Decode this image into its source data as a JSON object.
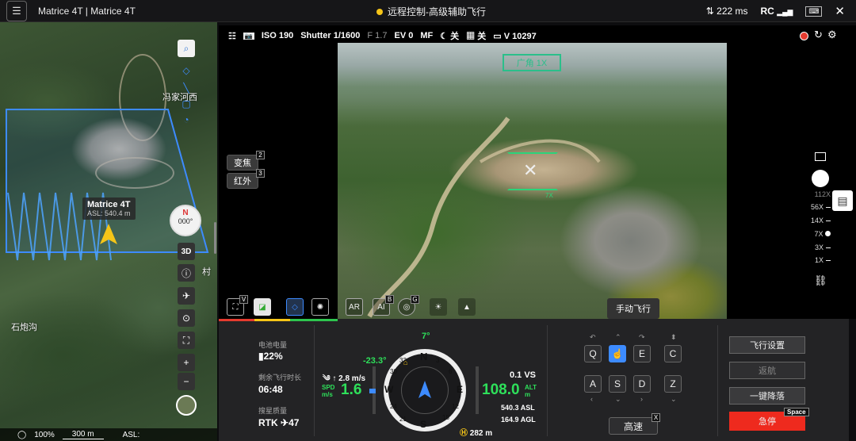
{
  "topbar": {
    "menu_icon": "menu-icon",
    "title": "Matrice 4T | Matrice 4T",
    "status": "远程控制-高级辅助飞行",
    "latency_icon": "signal-arrows-icon",
    "latency": "222 ms",
    "rc": "RC",
    "close": "✕"
  },
  "map": {
    "aircraft_name": "Matrice 4T",
    "aircraft_asl": "ASL: 540.4 m",
    "labels": {
      "village": "冯家河西",
      "place": "石炮沟",
      "east": "村"
    },
    "compass_n": "N",
    "compass_deg": "000°",
    "view_3d": "3D",
    "bottom": {
      "satellite": "100%",
      "scale": "300 m",
      "asl": "ASL:"
    }
  },
  "camera": {
    "iso": "ISO 190",
    "shutter": "Shutter 1/1600",
    "fstop": "F 1.7",
    "ev": "EV 0",
    "mf": "MF",
    "toggle1": "关",
    "toggle2": "关",
    "storage": "V 10297",
    "wide_label": "广角 1X",
    "zoom_center": "7X",
    "btn_visible": "变焦",
    "btn_visible_badge": "2",
    "btn_ir": "红外",
    "btn_ir_badge": "3",
    "zoom_levels": [
      "112X",
      "56X",
      "14X",
      "7X",
      "3X",
      "1X"
    ],
    "tool_badges": {
      "v": "V",
      "b": "B",
      "g": "G"
    }
  },
  "tooltip": "手动飞行",
  "panel": {
    "battery_label": "电池电量",
    "battery": "22%",
    "flighttime_label": "剩余飞行时长",
    "flighttime": "06:48",
    "rtk_label": "搜星质量",
    "rtk": "RTK",
    "satellites": "47",
    "heading": "7°",
    "pitch": "-23.3°",
    "speed_wind": "↑ 2.8 m/s",
    "spd_label": "SPD",
    "spd_unit": "m/s",
    "spd": "1.6",
    "vs": "0.1 VS",
    "alt": "108.0",
    "alt_label": "ALT",
    "alt_unit": "m",
    "asl": "540.3 ASL",
    "agl": "164.9 AGL",
    "home_dist": "282 m",
    "compass": {
      "n": "N",
      "e": "E",
      "s": "S",
      "w": "W",
      "t3": "3",
      "t6": "6",
      "t12": "12",
      "t15": "15",
      "t21": "21",
      "t24": "24",
      "t30": "30",
      "t33": "33"
    },
    "keys": [
      "Q",
      "W",
      "E",
      "C",
      "A",
      "S",
      "D",
      "Z"
    ],
    "high_speed": "高速",
    "high_speed_badge": "X",
    "buttons": {
      "flight_settings": "飞行设置",
      "rth": "返航",
      "land": "一键降落",
      "estop": "急停",
      "estop_key": "Space"
    }
  }
}
